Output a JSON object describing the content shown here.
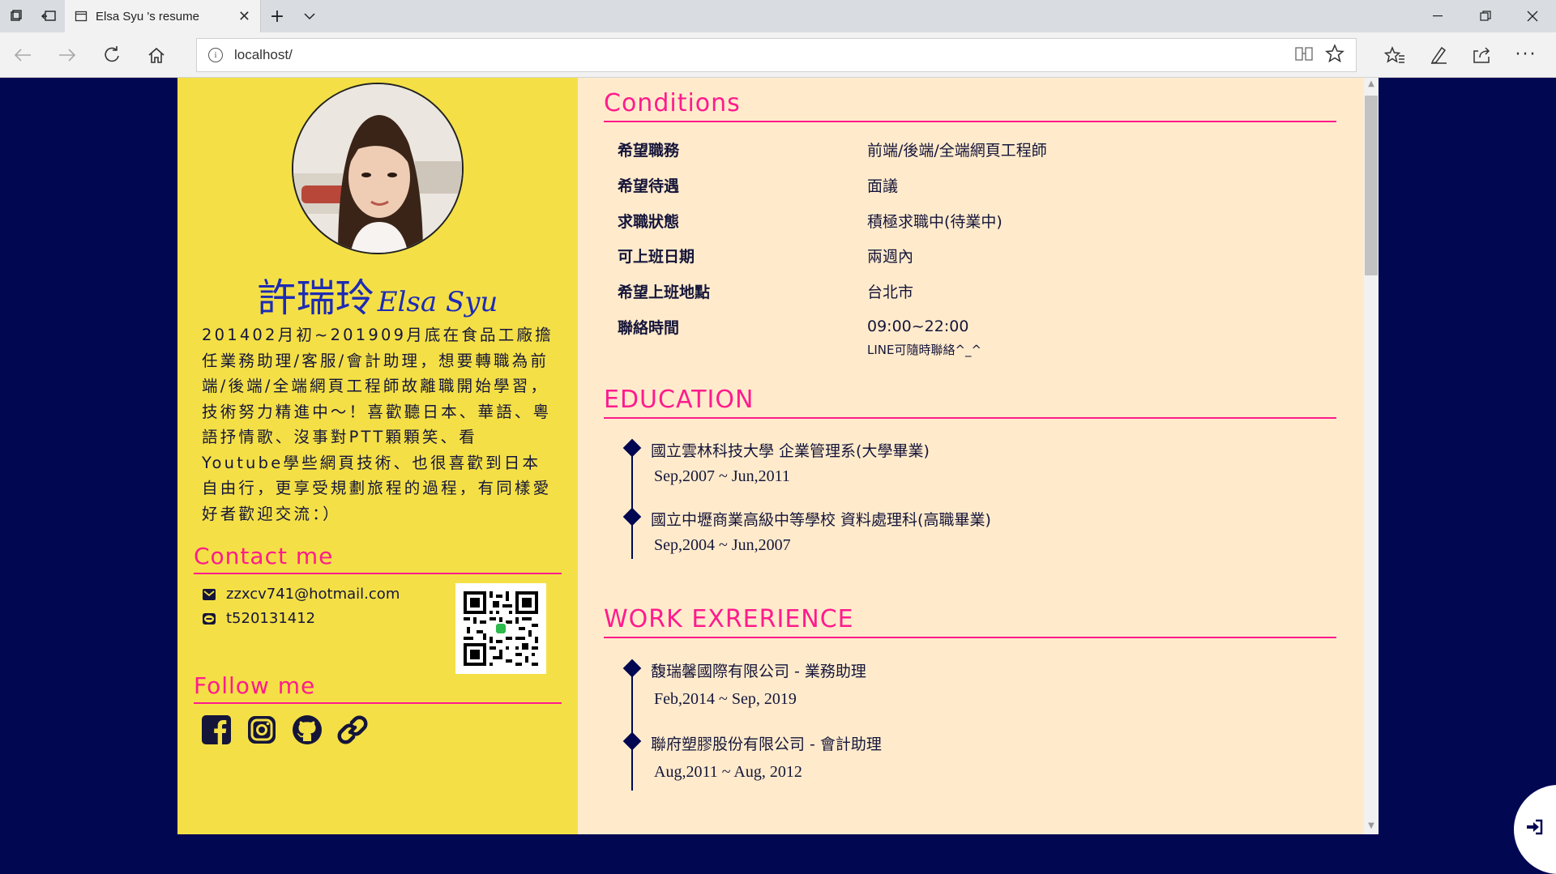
{
  "browser": {
    "tab_title": "Elsa Syu 's resume",
    "url": "localhost/"
  },
  "profile": {
    "name_zh": "許瑞玲",
    "name_en": "Elsa Syu",
    "bio": "201402月初~201909月底在食品工廠擔任業務助理/客服/會計助理，想要轉職為前端/後端/全端網頁工程師故離職開始學習，技術努力精進中～！喜歡聽日本、華語、粵語抒情歌、沒事對PTT顆顆笑、看Youtube學些網頁技術、也很喜歡到日本自由行，更享受規劃旅程的過程，有同樣愛好者歡迎交流：）"
  },
  "contact": {
    "heading": "Contact me",
    "email": "zzxcv741@hotmail.com",
    "line": "t520131412"
  },
  "follow": {
    "heading": "Follow me",
    "icons": [
      "facebook-icon",
      "instagram-icon",
      "github-icon",
      "link-icon"
    ]
  },
  "conditions": {
    "heading": "Conditions",
    "rows": [
      {
        "label": "希望職務",
        "value": "前端/後端/全端網頁工程師"
      },
      {
        "label": "希望待遇",
        "value": "面議"
      },
      {
        "label": "求職狀態",
        "value": "積極求職中(待業中)"
      },
      {
        "label": "可上班日期",
        "value": "兩週內"
      },
      {
        "label": "希望上班地點",
        "value": "台北市"
      },
      {
        "label": "聯絡時間",
        "value": "09:00~22:00",
        "note": "LINE可隨時聯絡^_^"
      }
    ]
  },
  "education": {
    "heading": "EDUCATION",
    "items": [
      {
        "title": "國立雲林科技大學 企業管理系(大學畢業)",
        "date": "Sep,2007 ~ Jun,2011"
      },
      {
        "title": "國立中壢商業高級中等學校 資料處理科(高職畢業)",
        "date": "Sep,2004 ~ Jun,2007"
      }
    ]
  },
  "work": {
    "heading": "WORK EXRERIENCE",
    "items": [
      {
        "title": "馥瑞馨國際有限公司 - 業務助理",
        "date": "Feb,2014 ~ Sep, 2019"
      },
      {
        "title": "聯府塑膠股份有限公司 - 會計助理",
        "date": "Aug,2011 ~ Aug, 2012"
      }
    ]
  },
  "colors": {
    "page_bg": "#020752",
    "sidebar_bg": "#f4e046",
    "main_bg": "#ffebcc",
    "accent": "#ff1b8d",
    "name": "#1d2bb5"
  }
}
